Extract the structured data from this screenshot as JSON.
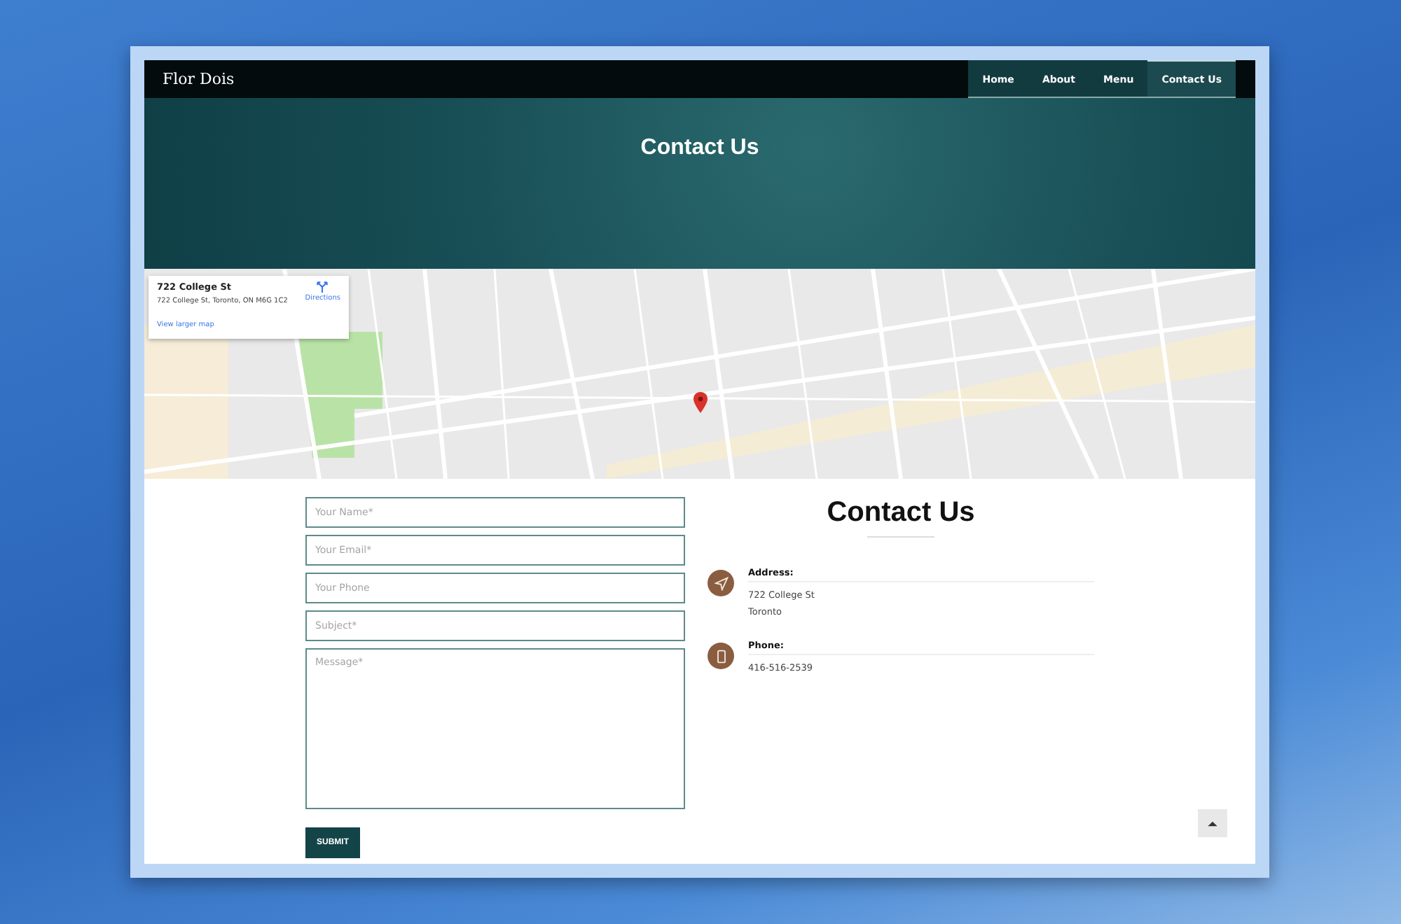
{
  "brand": "Flor Dois",
  "nav": [
    {
      "label": "Home",
      "selected": false
    },
    {
      "label": "About",
      "selected": false
    },
    {
      "label": "Menu",
      "selected": false
    },
    {
      "label": "Contact Us",
      "selected": true
    }
  ],
  "hero": {
    "title": "Contact Us"
  },
  "map_card": {
    "title": "722 College St",
    "address": "722 College St, Toronto, ON M6G 1C2",
    "directions": "Directions",
    "link": "View larger map"
  },
  "form": {
    "fields": [
      {
        "kind": "input",
        "placeholder": "Your Name*"
      },
      {
        "kind": "input",
        "placeholder": "Your Email*"
      },
      {
        "kind": "input",
        "placeholder": "Your Phone"
      },
      {
        "kind": "input",
        "placeholder": "Subject*"
      },
      {
        "kind": "textarea",
        "placeholder": "Message*"
      }
    ],
    "submit": "SUBMIT"
  },
  "contact": {
    "title": "Contact Us",
    "items": [
      {
        "kind": "address",
        "label": "Address:",
        "lines": [
          "722 College St",
          "Toronto"
        ]
      },
      {
        "kind": "phone",
        "label": "Phone:",
        "lines": [
          "416-516-2539"
        ]
      }
    ]
  }
}
